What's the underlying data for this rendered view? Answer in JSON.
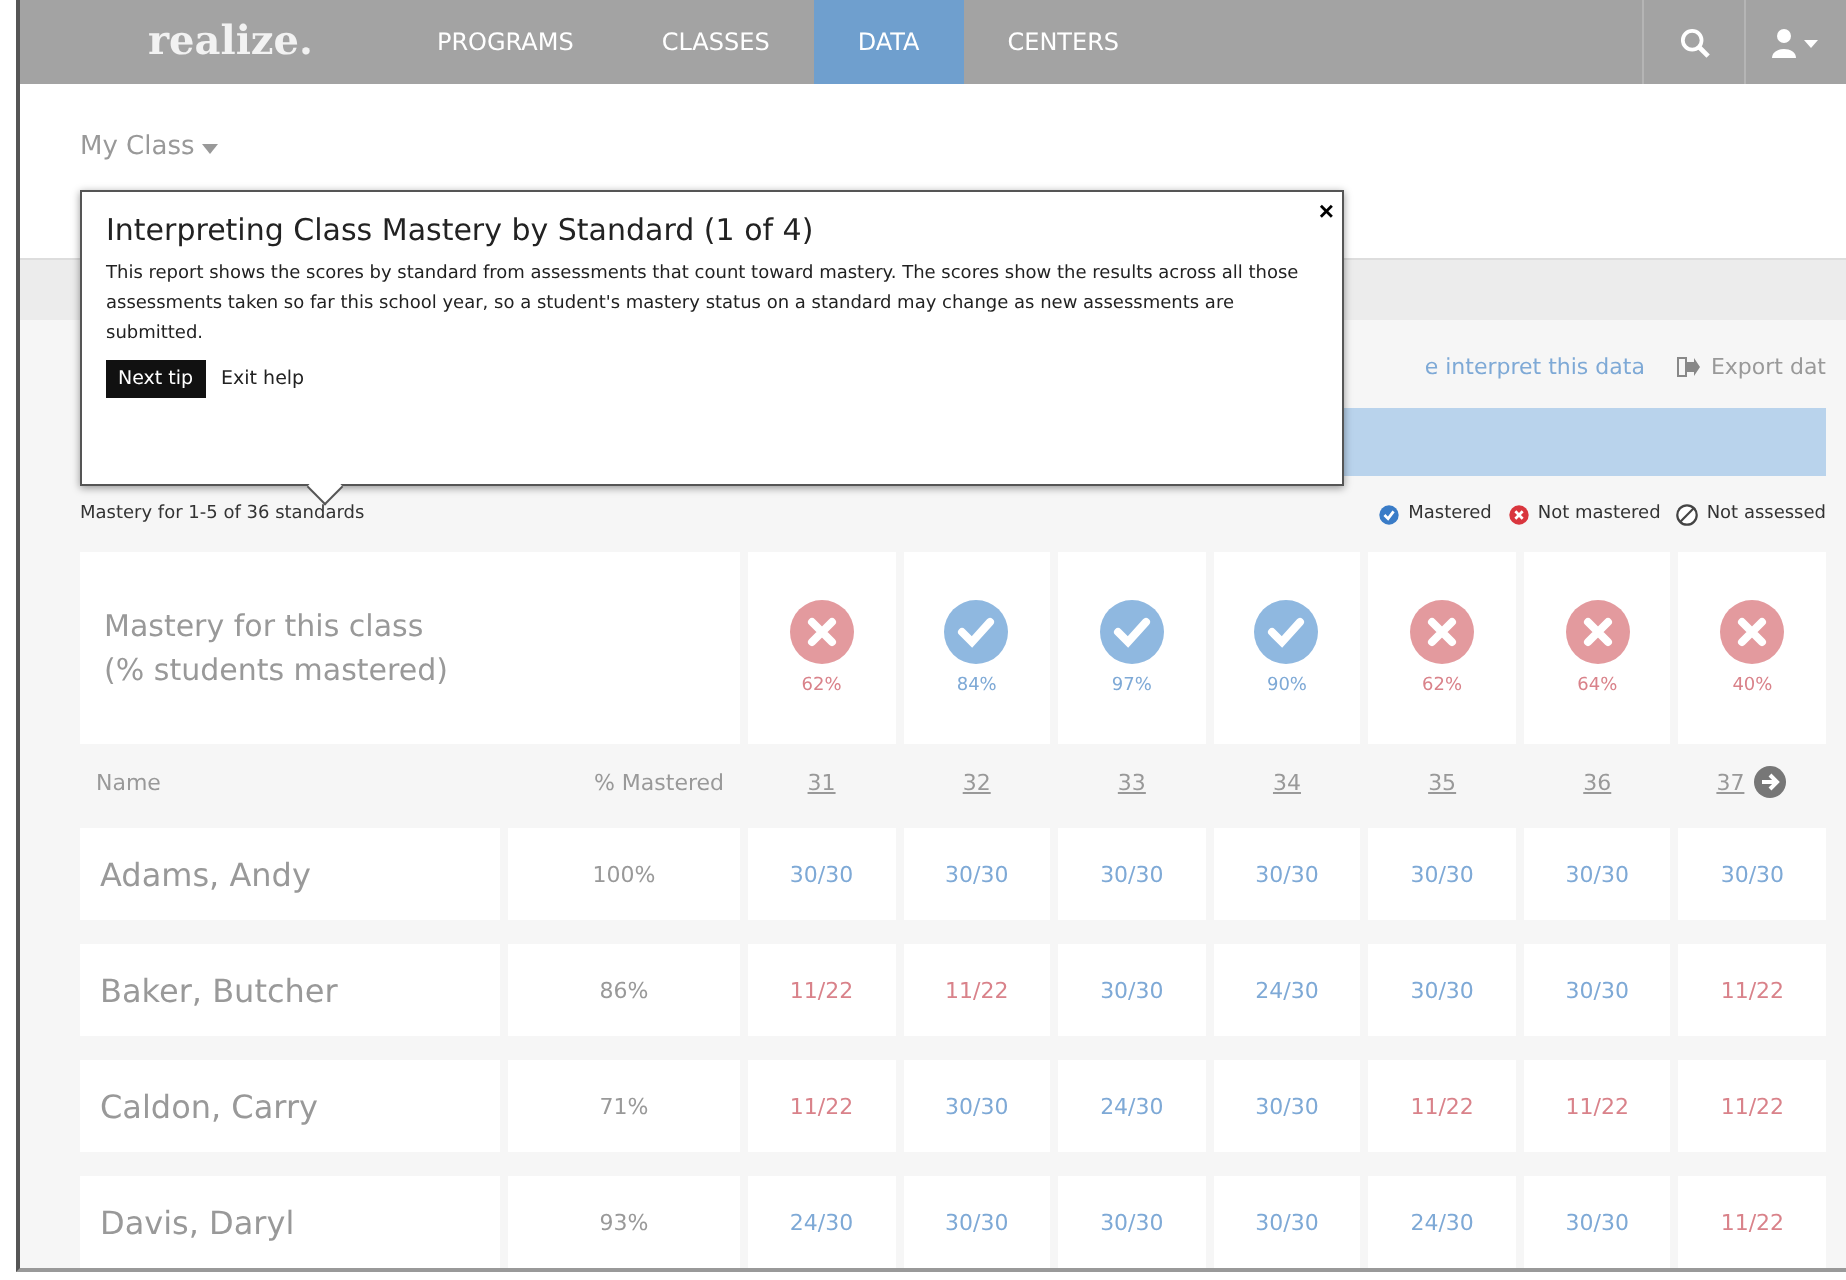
{
  "nav": {
    "logo": "realize.",
    "items": [
      {
        "label": "PROGRAMS",
        "selected": false
      },
      {
        "label": "CLASSES",
        "selected": false
      },
      {
        "label": "DATA",
        "selected": true
      },
      {
        "label": "CENTERS",
        "selected": false
      }
    ]
  },
  "class_selector": "My Class",
  "tooltip": {
    "title": "Interpreting Class Mastery by Standard (1 of 4)",
    "body": "This report shows the scores by standard from assessments that count toward mastery. The scores show the results across all those assessments taken so far this school year, so a student's mastery status on a standard may change as new assessments are submitted.",
    "next": "Next tip",
    "exit": "Exit help",
    "close": "×"
  },
  "links": {
    "interpret": "e interpret this data",
    "export": "Export dat"
  },
  "range": "Mastery for 1-5 of 36 standards",
  "legend": [
    {
      "kind": "mastered",
      "label": "Mastered"
    },
    {
      "kind": "not_mastered",
      "label": "Not mastered"
    },
    {
      "kind": "not_assessed",
      "label": "Not assessed"
    }
  ],
  "summary": {
    "label": "Mastery for this class",
    "sublabel": "(% students mastered)",
    "standards": [
      {
        "mastered": false,
        "percent": "62%"
      },
      {
        "mastered": true,
        "percent": "84%"
      },
      {
        "mastered": true,
        "percent": "97%"
      },
      {
        "mastered": true,
        "percent": "90%"
      },
      {
        "mastered": false,
        "percent": "62%"
      },
      {
        "mastered": false,
        "percent": "64%"
      },
      {
        "mastered": false,
        "percent": "40%"
      }
    ]
  },
  "table": {
    "columns": [
      "Name",
      "% Mastered"
    ],
    "standards": [
      "31",
      "32",
      "33",
      "34",
      "35",
      "36",
      "37"
    ],
    "rows": [
      {
        "name": "Adams, Andy",
        "percent": "100%",
        "scores": [
          {
            "value": "30/30",
            "mastered": true
          },
          {
            "value": "30/30",
            "mastered": true
          },
          {
            "value": "30/30",
            "mastered": true
          },
          {
            "value": "30/30",
            "mastered": true
          },
          {
            "value": "30/30",
            "mastered": true
          },
          {
            "value": "30/30",
            "mastered": true
          },
          {
            "value": "30/30",
            "mastered": true
          }
        ]
      },
      {
        "name": "Baker, Butcher",
        "percent": "86%",
        "scores": [
          {
            "value": "11/22",
            "mastered": false
          },
          {
            "value": "11/22",
            "mastered": false
          },
          {
            "value": "30/30",
            "mastered": true
          },
          {
            "value": "24/30",
            "mastered": true
          },
          {
            "value": "30/30",
            "mastered": true
          },
          {
            "value": "30/30",
            "mastered": true
          },
          {
            "value": "11/22",
            "mastered": false
          }
        ]
      },
      {
        "name": "Caldon, Carry",
        "percent": "71%",
        "scores": [
          {
            "value": "11/22",
            "mastered": false
          },
          {
            "value": "30/30",
            "mastered": true
          },
          {
            "value": "24/30",
            "mastered": true
          },
          {
            "value": "30/30",
            "mastered": true
          },
          {
            "value": "11/22",
            "mastered": false
          },
          {
            "value": "11/22",
            "mastered": false
          },
          {
            "value": "11/22",
            "mastered": false
          }
        ]
      },
      {
        "name": "Davis, Daryl",
        "percent": "93%",
        "scores": [
          {
            "value": "24/30",
            "mastered": true
          },
          {
            "value": "30/30",
            "mastered": true
          },
          {
            "value": "30/30",
            "mastered": true
          },
          {
            "value": "30/30",
            "mastered": true
          },
          {
            "value": "24/30",
            "mastered": true
          },
          {
            "value": "30/30",
            "mastered": true
          },
          {
            "value": "11/22",
            "mastered": false
          }
        ]
      }
    ]
  }
}
